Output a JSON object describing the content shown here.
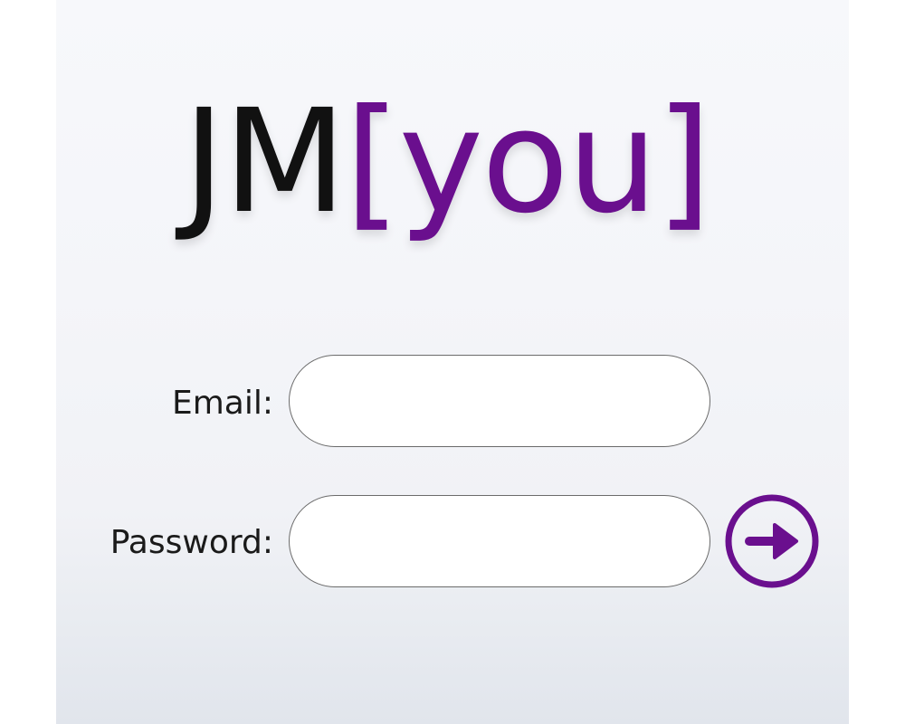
{
  "logo": {
    "part1": "JM",
    "part2": "[you]"
  },
  "form": {
    "email_label": "Email:",
    "email_value": "",
    "password_label": "Password:",
    "password_value": "",
    "submit_icon": "arrow-right-circle-icon"
  },
  "colors": {
    "brand_purple": "#6a0f8e",
    "logo_dark": "#111111"
  }
}
